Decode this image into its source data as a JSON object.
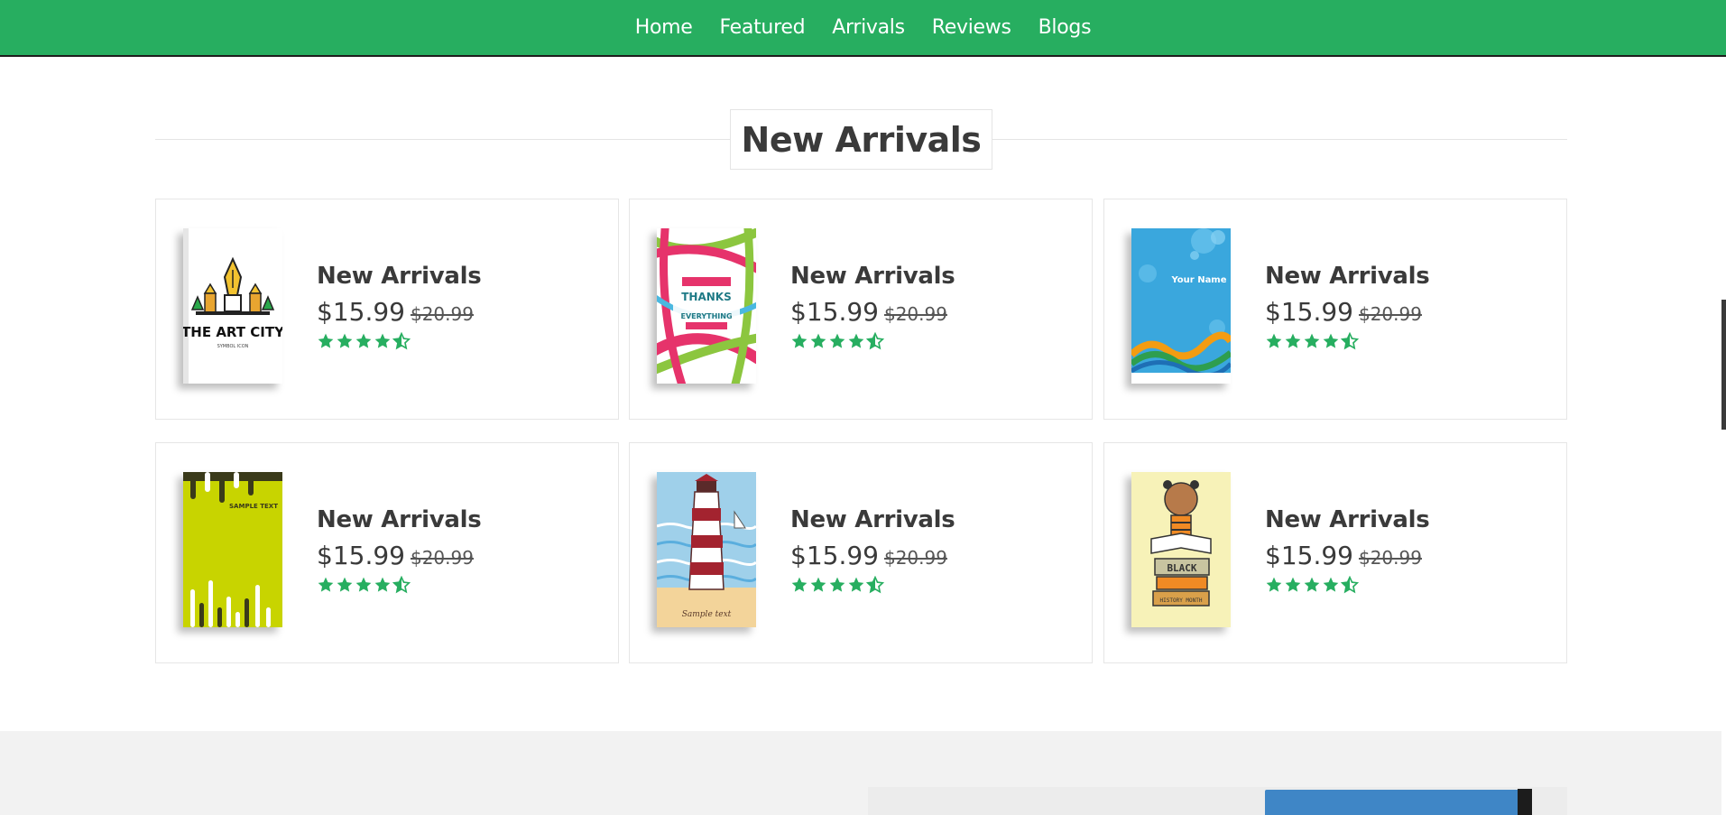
{
  "nav": {
    "items": [
      {
        "label": "Home"
      },
      {
        "label": "Featured"
      },
      {
        "label": "Arrivals"
      },
      {
        "label": "Reviews"
      },
      {
        "label": "Blogs"
      }
    ]
  },
  "section": {
    "heading": "New Arrivals"
  },
  "products": [
    {
      "title": "New Arrivals",
      "price": "$15.99",
      "old_price": "$20.99",
      "rating": 4.5,
      "cover": "art-city-book-cover",
      "cover_text": "THE ART CITY",
      "cover_subtext": "SYMBOL ICON"
    },
    {
      "title": "New Arrivals",
      "price": "$15.99",
      "old_price": "$20.99",
      "rating": 4.5,
      "cover": "give-thanks-book-cover",
      "cover_text": "THANKS",
      "cover_subtext": "EVERYTHING"
    },
    {
      "title": "New Arrivals",
      "price": "$15.99",
      "old_price": "$20.99",
      "rating": 4.5,
      "cover": "your-name-book-cover",
      "cover_text": "Your Name",
      "cover_subtext": ""
    },
    {
      "title": "New Arrivals",
      "price": "$15.99",
      "old_price": "$20.99",
      "rating": 4.5,
      "cover": "sample-text-book-cover",
      "cover_text": "SAMPLE TEXT",
      "cover_subtext": ""
    },
    {
      "title": "New Arrivals",
      "price": "$15.99",
      "old_price": "$20.99",
      "rating": 4.5,
      "cover": "lighthouse-book-cover",
      "cover_text": "Sample text",
      "cover_subtext": ""
    },
    {
      "title": "New Arrivals",
      "price": "$15.99",
      "old_price": "$20.99",
      "rating": 4.5,
      "cover": "black-history-month-book-cover",
      "cover_text": "BLACK",
      "cover_subtext": "HISTORY MONTH"
    }
  ],
  "colors": {
    "brand": "#27ae60",
    "star": "#27ae60",
    "text": "#3a3a3a"
  }
}
